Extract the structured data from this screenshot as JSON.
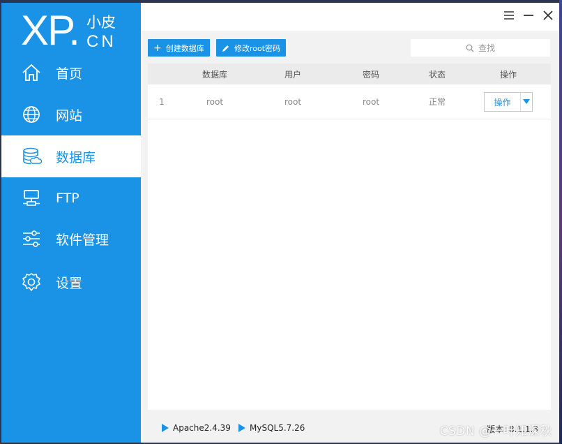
{
  "logo": {
    "main": "XP.",
    "sub_top": "小皮",
    "sub_bottom": "CN"
  },
  "sidebar": {
    "items": [
      {
        "label": "首页",
        "icon": "home-icon"
      },
      {
        "label": "网站",
        "icon": "globe-icon"
      },
      {
        "label": "数据库",
        "icon": "database-icon",
        "active": true
      },
      {
        "label": "FTP",
        "icon": "ftp-server-icon"
      },
      {
        "label": "软件管理",
        "icon": "sliders-icon"
      },
      {
        "label": "设置",
        "icon": "gear-icon"
      }
    ]
  },
  "toolbar": {
    "create_label": "创建数据库",
    "modify_label": "修改root密码",
    "search_placeholder": "查找"
  },
  "table": {
    "headers": [
      "数据库",
      "用户",
      "密码",
      "状态",
      "操作"
    ],
    "rows": [
      {
        "index": "1",
        "database": "root",
        "user": "root",
        "password": "root",
        "status": "正常",
        "action": "操作"
      }
    ]
  },
  "statusbar": {
    "services": [
      {
        "name": "Apache2.4.39"
      },
      {
        "name": "MySQL5.7.26"
      }
    ],
    "version": "版本: 8.1.1.3"
  },
  "watermark": "CSDN @一叶知深秋",
  "colors": {
    "accent": "#1a93e6",
    "window_bg": "#f2f2f2"
  }
}
